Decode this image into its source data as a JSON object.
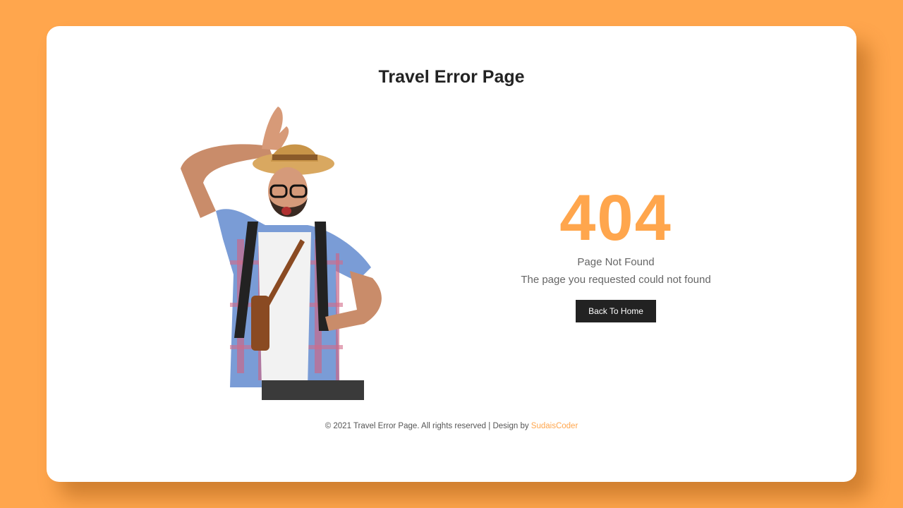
{
  "page": {
    "title": "Travel Error Page",
    "error_code": "404",
    "error_heading": "Page Not Found",
    "error_message": "The page you requested could not found",
    "button_label": "Back To Home"
  },
  "footer": {
    "text": "© 2021 Travel Error Page. All rights reserved | Design by",
    "author_link": "SudaisCoder"
  },
  "colors": {
    "accent": "#ffa64d",
    "code_color": "#ffa64d",
    "button_bg": "#222222",
    "card_bg": "#ffffff"
  },
  "illustration": {
    "icon": "surprised-tourist-illustration"
  }
}
